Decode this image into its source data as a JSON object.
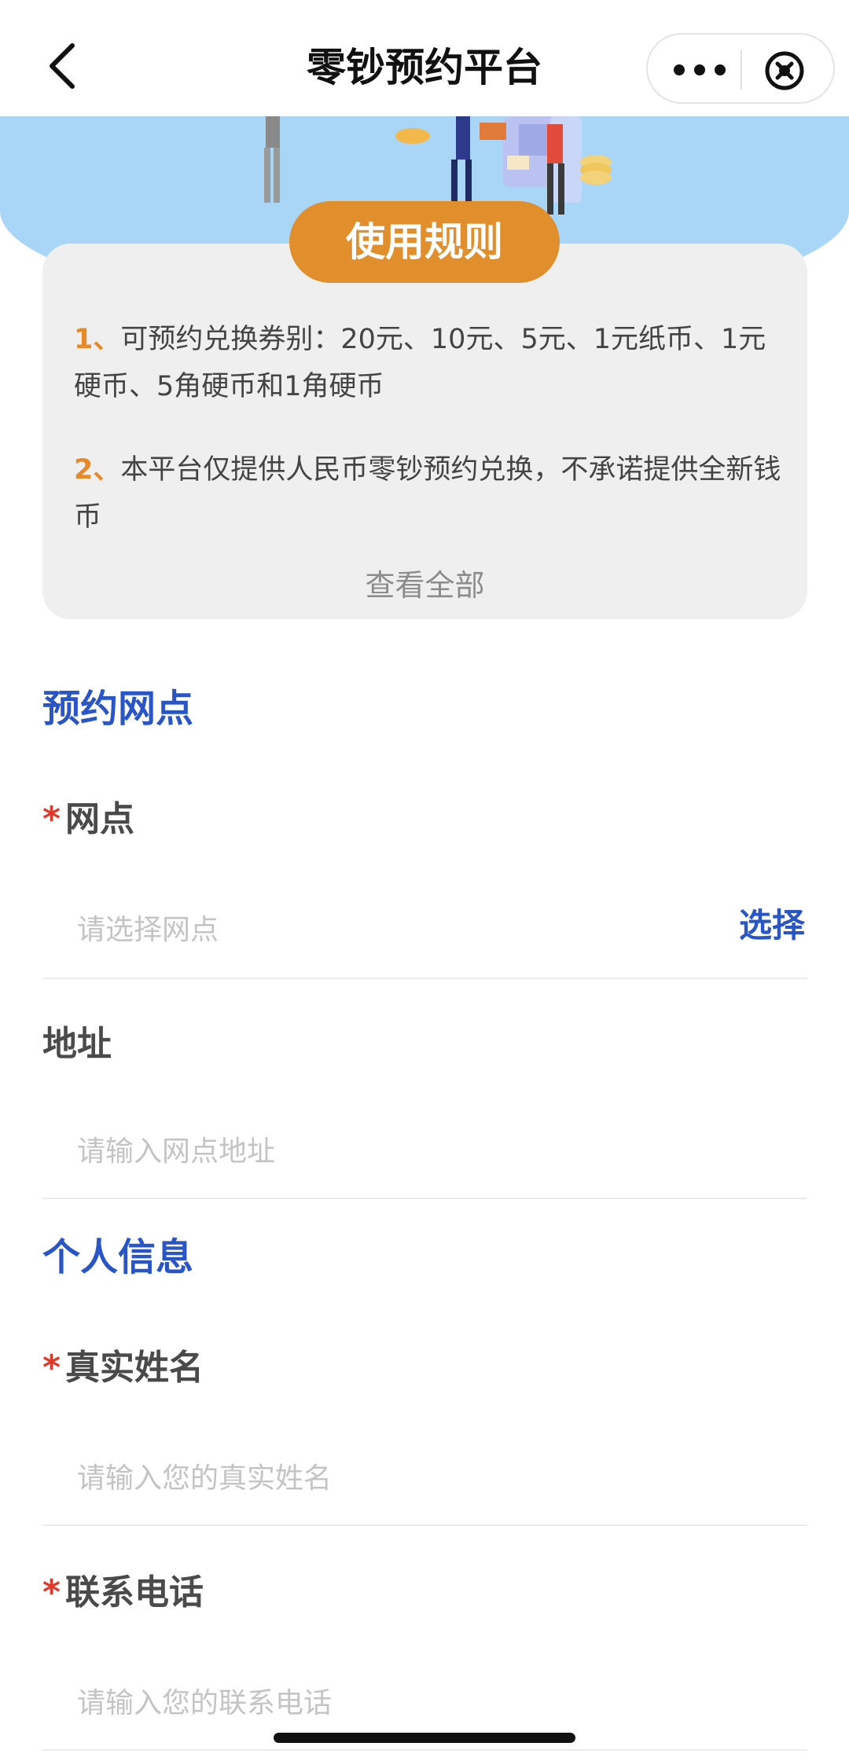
{
  "header": {
    "title": "零钞预约平台",
    "back_icon": "chevron-left-icon",
    "more_icon": "more-dots-icon",
    "close_icon": "close-circle-icon"
  },
  "rules": {
    "tab_label": "使用规则",
    "items": [
      {
        "num": "1",
        "sep": "、",
        "text": "可预约兑换券别：20元、10元、5元、1元纸币、1元硬币、5角硬币和1角硬币"
      },
      {
        "num": "2",
        "sep": "、",
        "text": "本平台仅提供人民币零钞预约兑换，不承诺提供全新钱币"
      }
    ],
    "view_all": "查看全部"
  },
  "branch_section": {
    "title": "预约网点",
    "branch": {
      "required_mark": "*",
      "label": "网点",
      "placeholder": "请选择网点",
      "action": "选择"
    },
    "address": {
      "label": "地址",
      "placeholder": "请输入网点地址"
    }
  },
  "personal_section": {
    "title": "个人信息",
    "name": {
      "required_mark": "*",
      "label": "真实姓名",
      "placeholder": "请输入您的真实姓名"
    },
    "phone": {
      "required_mark": "*",
      "label": "联系电话",
      "placeholder": "请输入您的联系电话"
    }
  },
  "colors": {
    "accent_blue": "#2a55c6",
    "orange": "#e08f2c",
    "banner_blue": "#a9d6f7",
    "required_red": "#e0392b"
  }
}
